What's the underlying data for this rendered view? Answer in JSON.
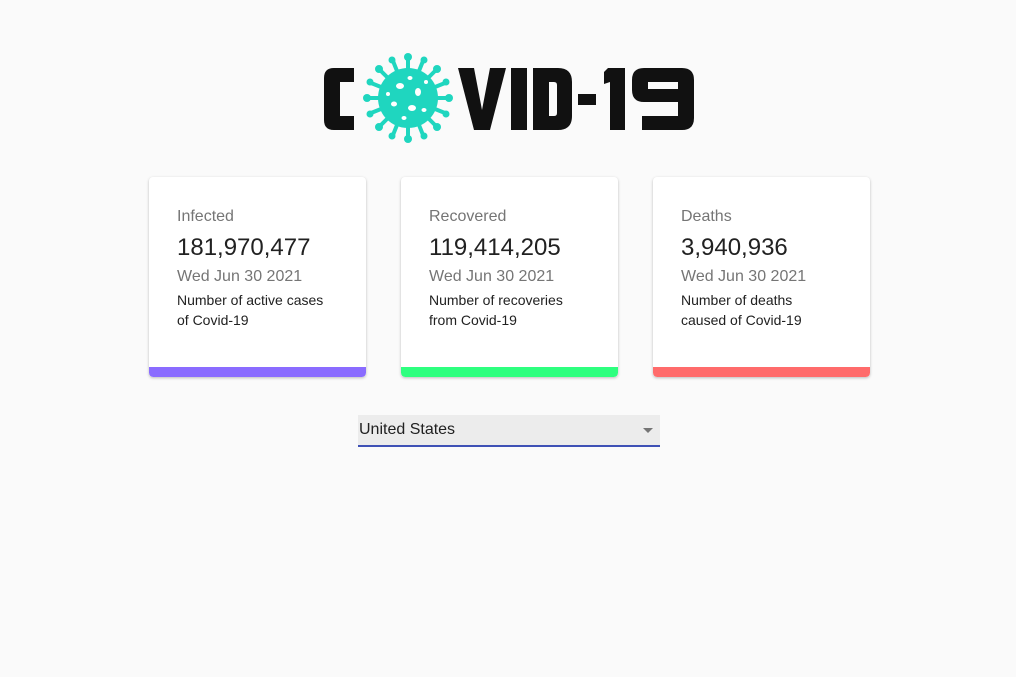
{
  "app": {
    "logo_text": "COVID-19",
    "colors": {
      "virus": "#1fd6bf",
      "logo_text": "#111111",
      "infected": "#8a6cff",
      "recovered": "#2eff7f",
      "deaths": "#ff6b6b",
      "select_underline": "#3f51b5"
    }
  },
  "cards": [
    {
      "title": "Infected",
      "count": "181,970,477",
      "date": "Wed Jun 30 2021",
      "description": "Number of active cases of Covid-19"
    },
    {
      "title": "Recovered",
      "count": "119,414,205",
      "date": "Wed Jun 30 2021",
      "description": "Number of recoveries from Covid-19"
    },
    {
      "title": "Deaths",
      "count": "3,940,936",
      "date": "Wed Jun 30 2021",
      "description": "Number of deaths caused of Covid-19"
    }
  ],
  "country_select": {
    "selected": "United States",
    "icon": "chevron-down-icon"
  }
}
